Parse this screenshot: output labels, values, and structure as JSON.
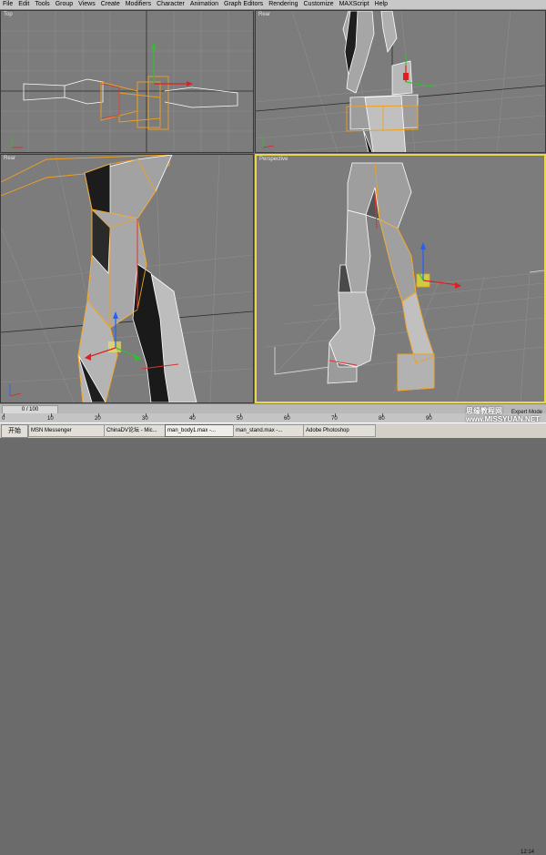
{
  "menu": [
    "File",
    "Edit",
    "Tools",
    "Group",
    "Views",
    "Create",
    "Modifiers",
    "Character",
    "Animation",
    "Graph Editors",
    "Rendering",
    "Customize",
    "MAXScript",
    "Help"
  ],
  "viewports": {
    "top": {
      "label": "Top"
    },
    "rear": {
      "label": "Rear"
    },
    "left": {
      "label": "Rear"
    },
    "perspective": {
      "label": "Perspective"
    }
  },
  "timeline": {
    "frame": "0 / 100",
    "ticks": [
      "0",
      "10",
      "20",
      "30",
      "40",
      "50",
      "60",
      "70",
      "80",
      "90"
    ]
  },
  "status": {
    "mode": "Expert Mode"
  },
  "taskbar": {
    "start": "开始",
    "items": [
      "MSN Messenger",
      "ChinaDV论坛 - Mic...",
      "man_body1.max -...",
      "man_stand.max -...",
      "Adobe Photoshop"
    ],
    "clock": "12:14"
  },
  "watermark": {
    "line1": "思缘教程网",
    "line2": "www.MISSYUAN.NET"
  },
  "colors": {
    "viewport_bg": "#7c7c7c",
    "grid": "#8e8e8e",
    "selection": "#f0a020",
    "active_border": "#e8d84a"
  }
}
